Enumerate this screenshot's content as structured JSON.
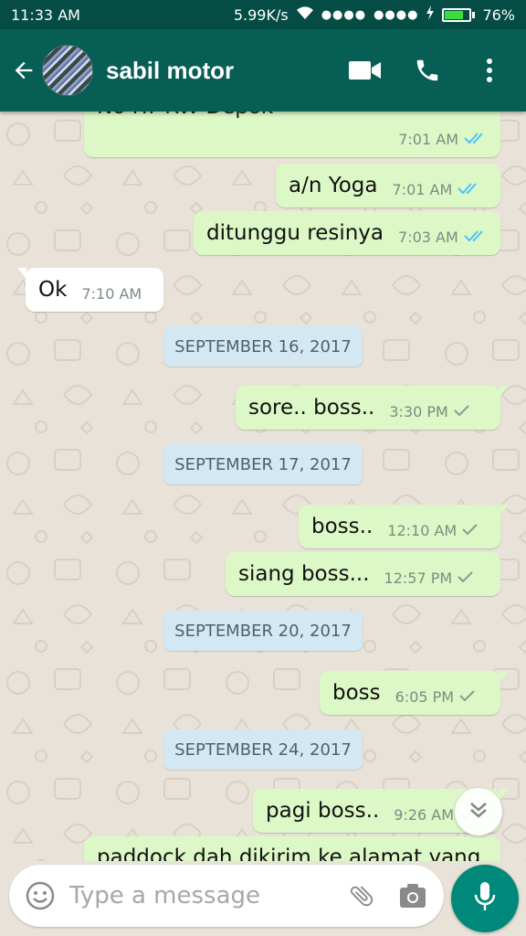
{
  "status_bar": {
    "time": "11:33 AM",
    "network_speed": "5.99K/s",
    "battery_percent": "76%",
    "battery_level": 0.76,
    "icons": [
      "wifi-icon",
      "signal-icon",
      "signal-icon",
      "charging-icon",
      "battery-icon"
    ]
  },
  "app_bar": {
    "contact_name": "sabil motor",
    "icons": [
      "back-arrow-icon",
      "video-call-icon",
      "voice-call-icon",
      "more-options-icon"
    ]
  },
  "messages": [
    {
      "type": "out",
      "text": "No   RT    RW    Depok",
      "time": "7:01 AM",
      "status": "read",
      "partial": "top"
    },
    {
      "type": "out",
      "text": "a/n Yoga",
      "time": "7:01 AM",
      "status": "read"
    },
    {
      "type": "out",
      "text": "ditunggu resinya",
      "time": "7:03 AM",
      "status": "read"
    },
    {
      "type": "in",
      "text": "Ok",
      "time": "7:10 AM"
    },
    {
      "type": "date",
      "text": "SEPTEMBER 16, 2017"
    },
    {
      "type": "out",
      "text": "sore.. boss..",
      "time": "3:30 PM",
      "status": "sent"
    },
    {
      "type": "date",
      "text": "SEPTEMBER 17, 2017"
    },
    {
      "type": "out",
      "text": "boss..",
      "time": "12:10 AM",
      "status": "sent"
    },
    {
      "type": "out",
      "text": "siang boss...",
      "time": "12:57 PM",
      "status": "sent"
    },
    {
      "type": "date",
      "text": "SEPTEMBER 20, 2017"
    },
    {
      "type": "out",
      "text": "boss",
      "time": "6:05 PM",
      "status": "sent"
    },
    {
      "type": "date",
      "text": "SEPTEMBER 24, 2017"
    },
    {
      "type": "out",
      "text": "pagi boss..",
      "time": "9:26 AM",
      "status": "sent"
    },
    {
      "type": "out",
      "text": "paddock dah dikirim ke alamat yang",
      "time": "",
      "status": "",
      "partial": "bottom"
    }
  ],
  "composer": {
    "placeholder": "Type a message",
    "icons": [
      "emoji-icon",
      "attach-icon",
      "camera-icon",
      "mic-icon"
    ]
  },
  "colors": {
    "header": "#075e54",
    "status_bar": "#054d44",
    "outgoing_bubble": "#dcf8c6",
    "incoming_bubble": "#ffffff",
    "date_chip": "#d4e8f3",
    "read_ticks": "#4fc3f7",
    "sent_ticks": "#8a9a90",
    "mic_button": "#00897b"
  }
}
